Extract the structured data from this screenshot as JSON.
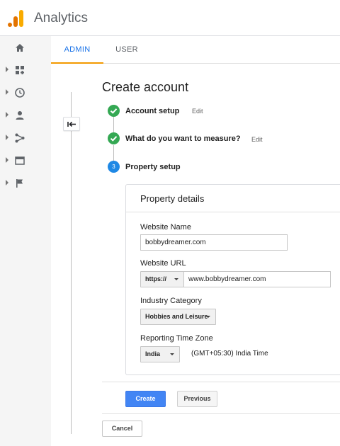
{
  "header": {
    "app_title": "Analytics"
  },
  "tabs": [
    {
      "label": "ADMIN",
      "active": true
    },
    {
      "label": "USER",
      "active": false
    }
  ],
  "leftnav": {
    "items": [
      "home-icon",
      "customization-icon",
      "realtime-clock-icon",
      "audience-person-icon",
      "acquisition-icon",
      "behavior-icon",
      "conversions-flag-icon"
    ]
  },
  "page": {
    "title": "Create account"
  },
  "steps": [
    {
      "label": "Account setup",
      "edit": "Edit",
      "state": "done"
    },
    {
      "label": "What do you want to measure?",
      "edit": "Edit",
      "state": "done"
    },
    {
      "number": "3",
      "label": "Property setup",
      "state": "current"
    }
  ],
  "property": {
    "title": "Property details",
    "website_name_label": "Website Name",
    "website_name_value": "bobbydreamer.com",
    "website_url_label": "Website URL",
    "protocol": "https://",
    "website_url_value": "www.bobbydreamer.com",
    "industry_label": "Industry Category",
    "industry_value": "Hobbies and Leisure",
    "timezone_label": "Reporting Time Zone",
    "country_value": "India",
    "timezone_value": "(GMT+05:30) India Time"
  },
  "buttons": {
    "create": "Create",
    "previous": "Previous",
    "cancel": "Cancel"
  },
  "colors": {
    "accent": "#1a73e8",
    "tab_underline": "#f29900",
    "step_done": "#34a853",
    "step_current": "#1e88e5",
    "create_button": "#4285f4"
  }
}
